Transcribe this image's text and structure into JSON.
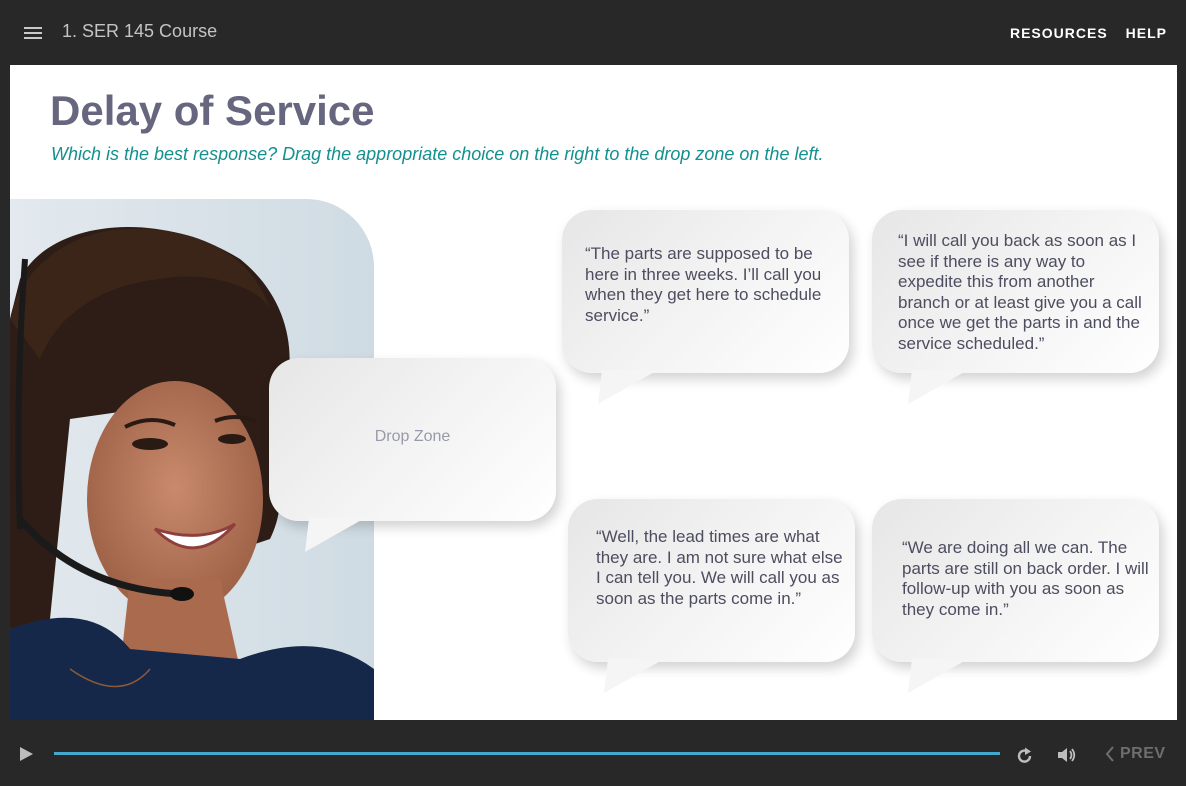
{
  "header": {
    "menu_icon": "hamburger-menu-icon",
    "course_title": "1. SER 145 Course",
    "links": [
      {
        "label": "RESOURCES"
      },
      {
        "label": "HELP"
      }
    ]
  },
  "slide": {
    "title": "Delay of Service",
    "instructions": "Which is the best response? Drag the appropriate choice on the right to the drop zone on the left.",
    "image": "customer-service-agent-with-headset-photo",
    "drop_zone": {
      "label": "Drop Zone"
    },
    "choices": [
      {
        "text": "“The parts are supposed to be here in three weeks. I’ll call you when they get here to schedule service.”"
      },
      {
        "text": "“I will call you back as soon as I see if there is any way to expedite this from another branch or at least give you a call once we get the parts in and the service scheduled.”"
      },
      {
        "text": "“Well, the lead times are what they are. I am not sure what else I can tell you. We will call you as soon as the parts come in.”"
      },
      {
        "text": "“We are doing all we can. The parts are still on back order. I will follow-up with you as soon as they come in.”"
      }
    ]
  },
  "colors": {
    "title": "#66667f",
    "instructions": "#13908f",
    "progress": "#43a9cc",
    "chrome": "#282828"
  },
  "player": {
    "play_icon": "play-icon",
    "progress_percent": 100,
    "replay_icon": "replay-icon",
    "volume_icon": "volume-icon",
    "prev_label": "PREV"
  }
}
